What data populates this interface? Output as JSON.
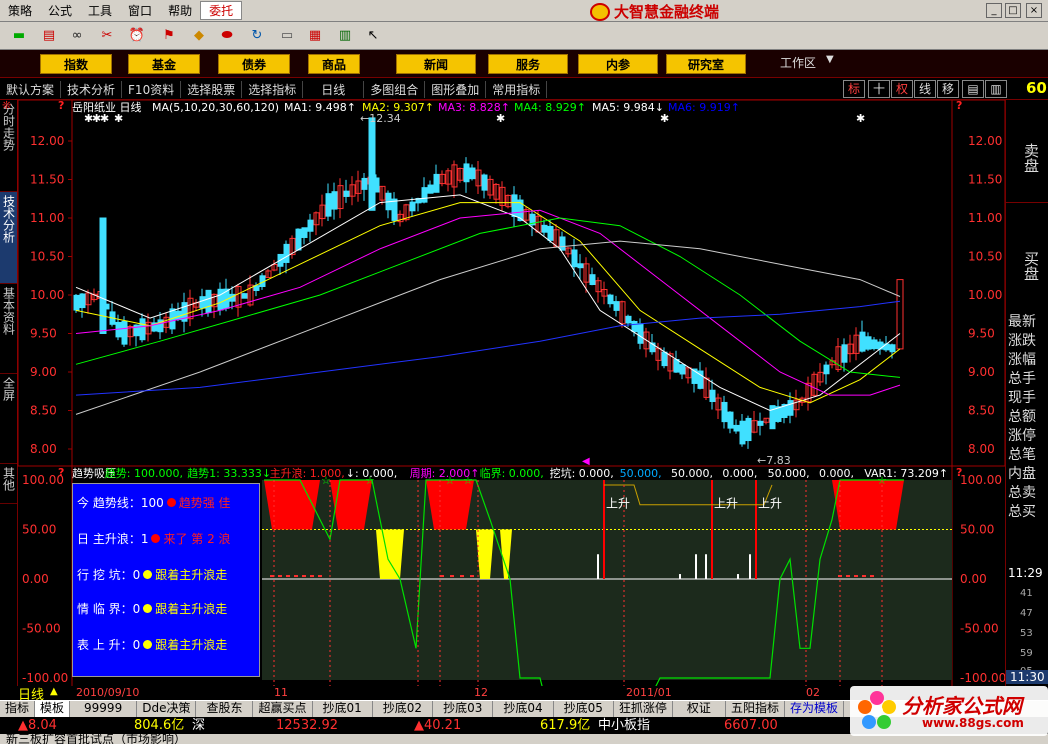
{
  "menubar": {
    "items": [
      "策略",
      "公式",
      "工具",
      "窗口",
      "帮助"
    ],
    "active": "委托",
    "brand": "大智慧金融终端",
    "controls": [
      "_",
      "□",
      "×"
    ]
  },
  "toolbar": {
    "icons": [
      "flag-icon",
      "book-icon",
      "binoculars-icon",
      "tools-icon",
      "alarm-icon",
      "flag-up-icon",
      "diamond-icon",
      "pill-icon",
      "sync-icon",
      "notepad-icon",
      "calendar-icon",
      "books-icon",
      "cursor-help-icon"
    ]
  },
  "navbar": {
    "buttons": [
      "指数",
      "基金",
      "债券",
      "商品",
      "新闻",
      "服务",
      "内参",
      "研究室"
    ],
    "workzone": "工作区"
  },
  "options": {
    "items": [
      "默认方案",
      "技术分析",
      "F10资料",
      "选择股票",
      "选择指标",
      "日线",
      "多图组合",
      "图形叠加",
      "常用指标"
    ],
    "tags": [
      "标",
      "十",
      "权",
      "线",
      "移"
    ],
    "corner_value": "60"
  },
  "left_tabs": [
    "分时走势",
    "技术分析",
    "基本资料",
    "全屏",
    "其他"
  ],
  "main_chart": {
    "stock_title": "岳阳纸业 日线",
    "ma_params": "MA(5,10,20,30,60,120)",
    "ma_labels": [
      {
        "text": "MA1: 9.498↑",
        "color": "#ffffff"
      },
      {
        "text": "MA2: 9.307↑",
        "color": "#ffff00"
      },
      {
        "text": "MA3: 8.828↑",
        "color": "#ff00ff"
      },
      {
        "text": "MA4: 8.929↑",
        "color": "#00ff00"
      },
      {
        "text": "MA5: 9.984↓",
        "color": "#ffffff"
      },
      {
        "text": "MA6: 9.919↑",
        "color": "#0000ff"
      }
    ],
    "high_label": "←12.34",
    "low_label": "←7.83",
    "y_ticks": [
      "12.00",
      "11.50",
      "11.00",
      "10.50",
      "10.00",
      "9.50",
      "9.00",
      "8.50",
      "8.00"
    ]
  },
  "indicator": {
    "header": [
      {
        "text": "趋势吸压",
        "color": "#ffffff"
      },
      {
        "text": "趋势: 100.000,",
        "color": "#00ff00"
      },
      {
        "text": "趋势1: 33.333↓",
        "color": "#00ff00"
      },
      {
        "text": "主升浪: 1.000,",
        "color": "#ff2020"
      },
      {
        "text": "↓: 0.000,",
        "color": "#ffffff"
      },
      {
        "text": "周期: 2.000↑",
        "color": "#ff00ff"
      },
      {
        "text": "临界: 0.000,",
        "color": "#00ff00"
      },
      {
        "text": "挖坑: 0.000,",
        "color": "#ffffff"
      },
      {
        "text": "50.000,",
        "color": "#00aaff"
      },
      {
        "text": "50.000,",
        "color": "#ffffff"
      },
      {
        "text": "0.000,",
        "color": "#ffffff"
      },
      {
        "text": "50.000,",
        "color": "#ffffff"
      },
      {
        "text": "0.000,",
        "color": "#ffffff"
      },
      {
        "text": "VAR1: 73.209↑",
        "color": "#ffffff"
      }
    ],
    "y_ticks": [
      "100.00",
      "50.00",
      "0.00",
      "-50.00",
      "-100.00"
    ],
    "rise_labels": [
      "上升",
      "上升",
      "上升"
    ],
    "panel": [
      {
        "label": "今  趋势线：100",
        "status": "趋势强 佳",
        "dot": "red"
      },
      {
        "label": "日  主升浪：1",
        "status": "来了 第 2 浪",
        "dot": "red"
      },
      {
        "label": "行  挖  坑：0",
        "status": "跟着主升浪走",
        "dot": "yellow"
      },
      {
        "label": "情  临  界：0",
        "status": "跟着主升浪走",
        "dot": "yellow"
      },
      {
        "label": "表  上  升：0",
        "status": "跟着主升浪走",
        "dot": "yellow"
      }
    ]
  },
  "right_panel": {
    "sell": "卖盘",
    "buy": "买盘",
    "items": [
      "最新",
      "涨跌",
      "涨幅",
      "总手",
      "现手",
      "总额",
      "涨停",
      "总笔",
      "内盘",
      "总卖",
      "总买"
    ],
    "time": "11:29",
    "ticks": [
      "41",
      "47",
      "53",
      "59",
      "05"
    ],
    "time2": "11:30"
  },
  "datebar": {
    "period": "日线",
    "dates": [
      "2010/09/10",
      "11",
      "12",
      "2011/01",
      "02"
    ]
  },
  "tabbar": {
    "tabs": [
      "指标",
      "模板",
      "99999",
      "Dde决策",
      "查股东",
      "超赢买点",
      "抄底01",
      "抄底02",
      "抄底03",
      "抄底04",
      "抄底05",
      "狂抓涨停",
      "权证",
      "五阳指标",
      "存为模板"
    ],
    "active": "模板"
  },
  "quotes": [
    {
      "text": "▲8.04",
      "color": "#ff3030"
    },
    {
      "text": "804.6亿",
      "color": "#ffff00"
    },
    {
      "text": "深",
      "color": "#ffffff"
    },
    {
      "text": "12532.92",
      "color": "#ff3030"
    },
    {
      "text": "▲40.21",
      "color": "#ff3030"
    },
    {
      "text": "617.9亿",
      "color": "#ffff00"
    },
    {
      "text": "中小板指",
      "color": "#ffffff"
    },
    {
      "text": "6607.00",
      "color": "#ff3030"
    }
  ],
  "status": "新三板扩容首批试点（市场影响）",
  "watermark": {
    "title": "分析家公式网",
    "url": "www.88gs.com"
  }
}
